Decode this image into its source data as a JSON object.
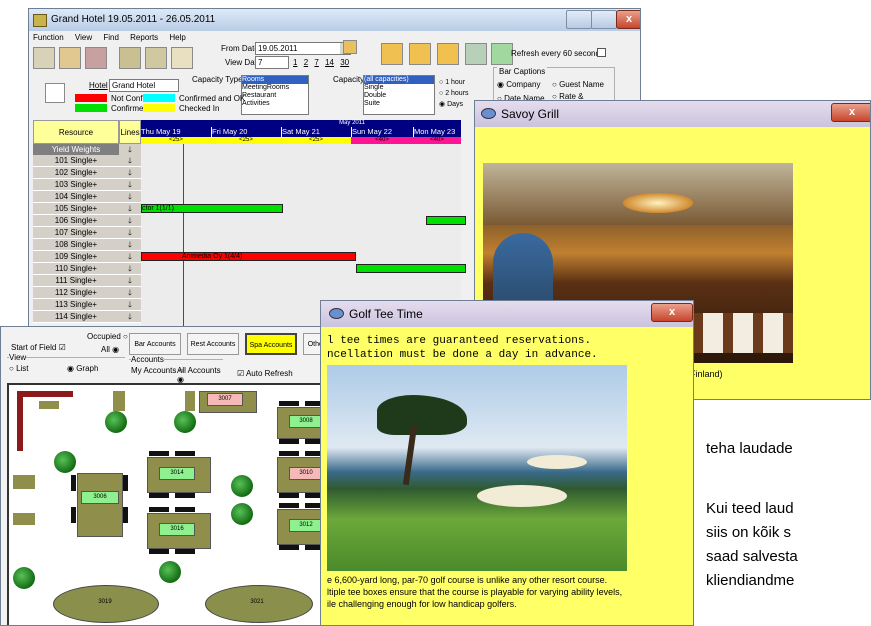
{
  "hotel_window": {
    "title": "Grand Hotel 19.05.2011 - 26.05.2011",
    "menu": [
      "Function",
      "View",
      "Find",
      "Reports",
      "Help"
    ],
    "from_date_label": "From Date:",
    "from_date_value": "19.05.2011",
    "view_days_label": "View Days:",
    "view_days_value": "7",
    "view_days_options": [
      "1",
      "2",
      "7",
      "14",
      "30"
    ],
    "refresh_label": "Refresh every 60 seconds",
    "hotel_label": "Hotel",
    "hotel_value": "Grand Hotel",
    "capacity_type_label": "Capacity Type:",
    "capacity_type_options": [
      "Rooms",
      "MeetingRooms",
      "Restaurant",
      "Activities"
    ],
    "capacity_label": "Capacity",
    "capacity_options": [
      "(all capacities)",
      "Single",
      "Double",
      "Suite"
    ],
    "interval_options": [
      "1 hour",
      "2 hours",
      "Days"
    ],
    "bar_captions_label": "Bar Captions",
    "bar_caption_options": [
      "Company",
      "Guest Name",
      "Date Name",
      "Rate &"
    ],
    "legend": [
      {
        "label": "Not Confirmed",
        "color": "#ff0000"
      },
      {
        "label": "Confirmed and OK",
        "color": "#00ffff"
      },
      {
        "label": "Confirmed",
        "color": "#00e000"
      },
      {
        "label": "Checked In",
        "color": "#ffff00"
      }
    ],
    "resource_header": "Resource",
    "lines_header": "Lines",
    "month_label": "May 2011",
    "days": [
      "Thu May 19",
      "Fri May 20",
      "Sat May 21",
      "Sun May 22",
      "Mon May 23"
    ],
    "day_counts": [
      "<25>",
      "<25>",
      "<25>",
      "<40>",
      "<40>"
    ],
    "yield_label": "Yield Weights",
    "rooms": [
      "101 Single+",
      "102 Single+",
      "103 Single+",
      "104 Single+",
      "105 Single+",
      "106 Single+",
      "107 Single+",
      "108 Single+",
      "109 Single+",
      "110 Single+",
      "111 Single+",
      "112 Single+",
      "113 Single+",
      "114 Single+"
    ],
    "bar_105": "ctor 1(1/1)",
    "bar_109": "Animedia Oy 1(4/4)"
  },
  "savoy_window": {
    "title": "Savoy Grill",
    "caption": "ki Finland)"
  },
  "golf_window": {
    "title": "Golf Tee Time",
    "line1": "l tee times are guaranteed reservations.",
    "line2": "ncellation must be done a day in advance.",
    "desc1": "e 6,600-yard long, par-70 golf course is unlike any other resort course.",
    "desc2": "ltiple tee boxes ensure that the course is playable for varying ability levels,",
    "desc3": "ile challenging enough for low handicap golfers."
  },
  "floor_window": {
    "start_of_field": "Start of Field",
    "occupied": "Occupied",
    "all": "All",
    "view_label": "View",
    "view_list": "List",
    "view_graph": "Graph",
    "tabs": [
      "Bar Accounts",
      "Rest Accounts",
      "Spa Accounts",
      "Other Accou"
    ],
    "accounts_label": "Accounts",
    "my_accounts": "My Accounts",
    "all_accounts": "All Accounts",
    "auto_refresh": "Auto Refresh",
    "tables": [
      "3007",
      "3008",
      "3014",
      "3010",
      "3006",
      "3016",
      "3012",
      "3019",
      "3021"
    ]
  },
  "estonian_text": {
    "line1": "teha laudade",
    "line2": "Kui teed laud",
    "line3": "siis on kõik s",
    "line4": "saad salvesta",
    "line5": "kliendiandme"
  },
  "colors": {
    "navy": "#000080",
    "yellow_panel": "#ffff66",
    "magenta": "#ff1493"
  }
}
